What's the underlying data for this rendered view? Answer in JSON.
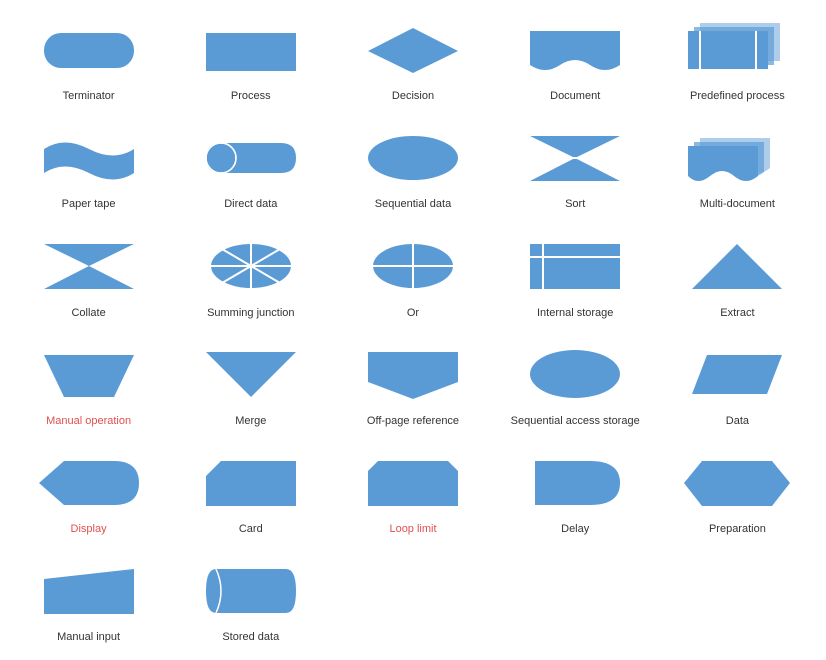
{
  "shapes": [
    {
      "name": "terminator",
      "label": "Terminator",
      "red": false
    },
    {
      "name": "process",
      "label": "Process",
      "red": false
    },
    {
      "name": "decision",
      "label": "Decision",
      "red": false
    },
    {
      "name": "document",
      "label": "Document",
      "red": false
    },
    {
      "name": "predefined-process",
      "label": "Predefined process",
      "red": false
    },
    {
      "name": "paper-tape",
      "label": "Paper tape",
      "red": false
    },
    {
      "name": "direct-data",
      "label": "Direct data",
      "red": false
    },
    {
      "name": "sequential-data",
      "label": "Sequential data",
      "red": false
    },
    {
      "name": "sort",
      "label": "Sort",
      "red": false
    },
    {
      "name": "multi-document",
      "label": "Multi-document",
      "red": false
    },
    {
      "name": "collate",
      "label": "Collate",
      "red": false
    },
    {
      "name": "summing-junction",
      "label": "Summing junction",
      "red": false
    },
    {
      "name": "or",
      "label": "Or",
      "red": false
    },
    {
      "name": "internal-storage",
      "label": "Internal storage",
      "red": false
    },
    {
      "name": "extract",
      "label": "Extract",
      "red": false
    },
    {
      "name": "manual-operation",
      "label": "Manual operation",
      "red": true
    },
    {
      "name": "merge",
      "label": "Merge",
      "red": false
    },
    {
      "name": "off-page-reference",
      "label": "Off-page reference",
      "red": false
    },
    {
      "name": "sequential-access-storage",
      "label": "Sequential access storage",
      "red": false
    },
    {
      "name": "data",
      "label": "Data",
      "red": false
    },
    {
      "name": "display",
      "label": "Display",
      "red": true
    },
    {
      "name": "card",
      "label": "Card",
      "red": false
    },
    {
      "name": "loop-limit",
      "label": "Loop limit",
      "red": true
    },
    {
      "name": "delay",
      "label": "Delay",
      "red": false
    },
    {
      "name": "preparation",
      "label": "Preparation",
      "red": false
    },
    {
      "name": "manual-input",
      "label": "Manual input",
      "red": false
    },
    {
      "name": "stored-data",
      "label": "Stored data",
      "red": false
    }
  ]
}
